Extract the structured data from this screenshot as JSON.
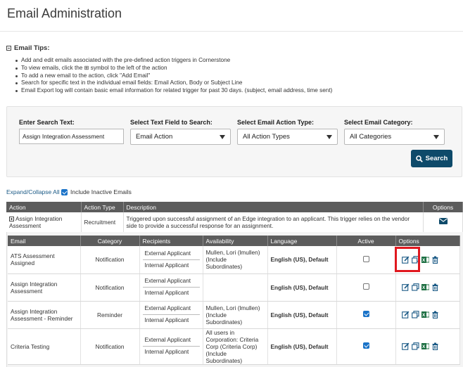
{
  "page": {
    "title": "Email Administration"
  },
  "tips": {
    "heading": "Email Tips:",
    "items": [
      "Add and edit emails associated with the pre-defined action triggers in Cornerstone",
      "To view emails, click the ⊞ symbol to the left of the action",
      "To add a new email to the action, click \"Add Email\"",
      "Search for specific text in the individual email fields: Email Action, Body or Subject Line",
      "Email Export log will contain basic email information for related trigger for past 30 days. (subject, email address, time sent)"
    ]
  },
  "search": {
    "text_label": "Enter Search Text:",
    "text_value": "Assign Integration Assessment",
    "field_label": "Select Text Field to Search:",
    "field_value": "Email Action",
    "action_label": "Select Email Action Type:",
    "action_value": "All Action Types",
    "category_label": "Select Email Category:",
    "category_value": "All Categories",
    "button_label": "Search"
  },
  "controls": {
    "expand_collapse": "Expand/Collapse All",
    "include_inactive": "Include Inactive Emails",
    "include_inactive_checked": true
  },
  "actions_table": {
    "headers": [
      "Action",
      "Action Type",
      "Description",
      "Options"
    ],
    "row": {
      "action": "Assign Integration Assessment",
      "type": "Recruitment",
      "description": "Triggered upon successful assignment of an Edge integration to an applicant. This trigger relies on the vendor side to provide a successful response for an assignment."
    }
  },
  "emails_table": {
    "headers": [
      "Email",
      "Category",
      "Recipients",
      "Availability",
      "Language",
      "Active",
      "Options"
    ],
    "rows": [
      {
        "email": "ATS Assessment Assigned",
        "category": "Notification",
        "recipients": [
          "External Applicant",
          "Internal Applicant"
        ],
        "availability": "Mullen, Lori (lmullen) (Include Subordinates)",
        "language": "English (US), Default",
        "active": false
      },
      {
        "email": "Assign Integration Assessment",
        "category": "Notification",
        "recipients": [
          "External Applicant",
          "Internal Applicant"
        ],
        "availability": "",
        "language": "English (US), Default",
        "active": false
      },
      {
        "email": "Assign Integration Assessment - Reminder",
        "category": "Reminder",
        "recipients": [
          "External Applicant",
          "Internal Applicant"
        ],
        "availability": "Mullen, Lori (lmullen) (Include Subordinates)",
        "language": "English (US), Default",
        "active": true
      },
      {
        "email": "Criteria Testing",
        "category": "Notification",
        "recipients": [
          "External Applicant",
          "Internal Applicant"
        ],
        "availability": "All users in Corporation: Criteria Corp (Criteria Corp) (Include Subordinates)",
        "language": "English (US), Default",
        "active": true
      }
    ]
  },
  "colors": {
    "primary": "#0e4a6a",
    "link": "#1b5a86",
    "header_bg": "#5c5c5c",
    "highlight": "#e0181f",
    "icon": "#1b5a86",
    "excel": "#1d6f42"
  },
  "icons": [
    "edit-icon",
    "copy-icon",
    "excel-export-icon",
    "trash-icon",
    "envelope-icon",
    "search-icon",
    "expand-plus-icon",
    "collapse-minus-icon"
  ]
}
